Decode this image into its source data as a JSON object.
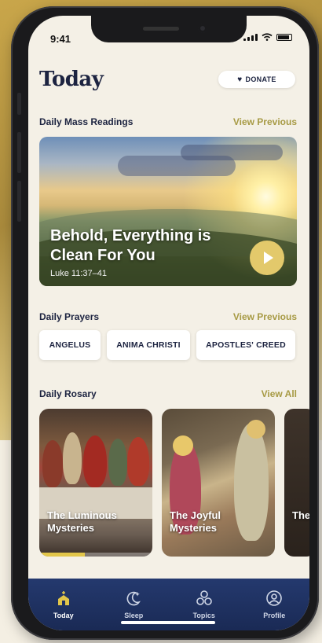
{
  "status_bar": {
    "time": "9:41"
  },
  "header": {
    "title": "Today",
    "donate_label": "DONATE"
  },
  "mass_readings": {
    "label": "Daily Mass Readings",
    "link": "View Previous",
    "title": "Behold, Everything is Clean For You",
    "reference": "Luke 11:37–41"
  },
  "prayers": {
    "label": "Daily Prayers",
    "link": "View Previous",
    "items": [
      {
        "label": "ANGELUS"
      },
      {
        "label": "ANIMA CHRISTI"
      },
      {
        "label": "APOSTLES' CREED"
      }
    ]
  },
  "rosary": {
    "label": "Daily Rosary",
    "link": "View All",
    "items": [
      {
        "label": "The Luminous Mysteries",
        "progress": 0.4
      },
      {
        "label": "The Joyful Mysteries"
      },
      {
        "label": "The My"
      }
    ]
  },
  "tabs": [
    {
      "label": "Today",
      "icon": "church-icon",
      "active": true
    },
    {
      "label": "Sleep",
      "icon": "moon-icon"
    },
    {
      "label": "Topics",
      "icon": "topics-icon"
    },
    {
      "label": "Profile",
      "icon": "profile-icon"
    }
  ],
  "colors": {
    "navy": "#1c2340",
    "accent_gold": "#a79a44",
    "tabbar": "#24396e",
    "background": "#f4f0e6"
  }
}
